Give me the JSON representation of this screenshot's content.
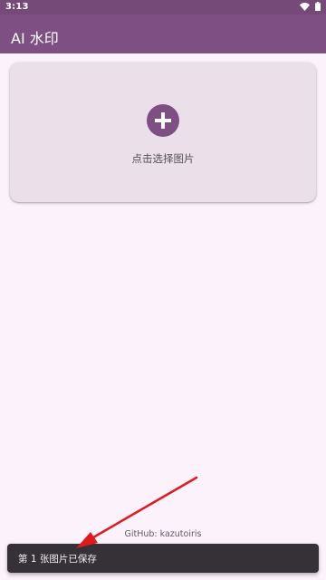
{
  "status_bar": {
    "time": "3:13",
    "wifi_icon": "wifi-icon",
    "battery_icon": "battery-icon"
  },
  "app_bar": {
    "title": "AI 水印"
  },
  "picker": {
    "label": "点击选择图片",
    "icon": "plus-circle-icon"
  },
  "footer": {
    "github": "GitHub: kazutoiris"
  },
  "snackbar": {
    "message": "第 1 张图片已保存"
  },
  "colors": {
    "primary": "#7e4f83",
    "status_bar": "#754a79",
    "background": "#fcf2fc",
    "card": "#ebe0ea",
    "snackbar": "#353137",
    "annotation_arrow": "#e0191c"
  }
}
